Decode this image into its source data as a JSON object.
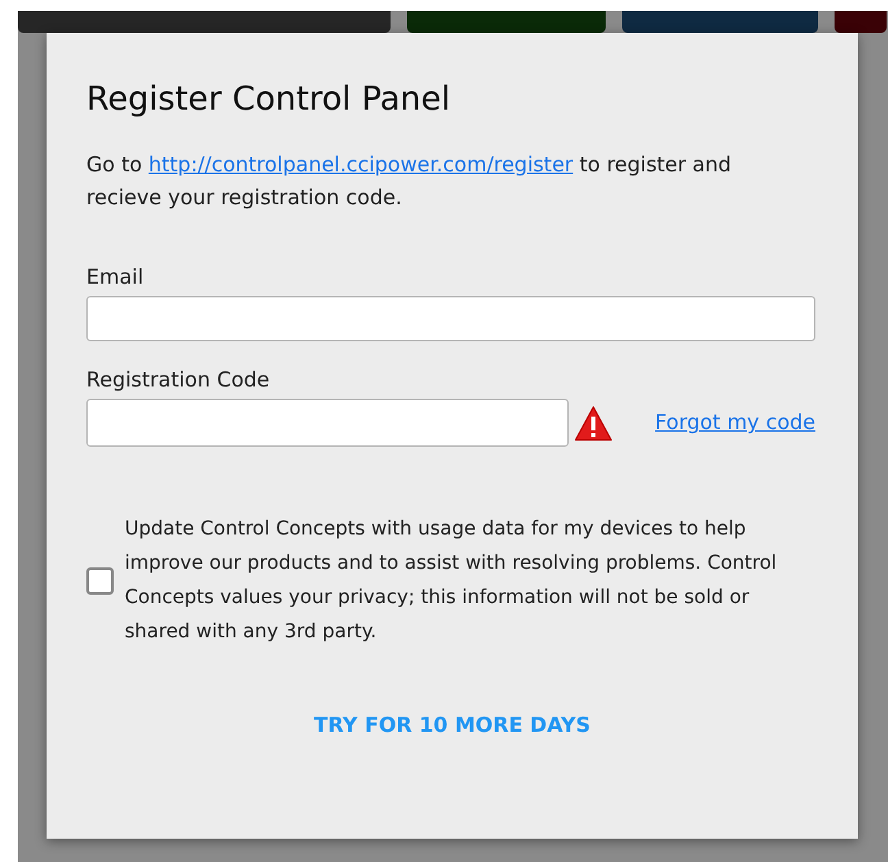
{
  "background_tabs": [
    {
      "color": "#262626"
    },
    {
      "color": "#0a2a08"
    },
    {
      "color": "#0f2a42"
    },
    {
      "color": "#3a0206"
    }
  ],
  "dialog": {
    "title": "Register Control Panel",
    "intro": {
      "before": "Go to ",
      "link": "http://controlpanel.ccipower.com/register",
      "after": " to register and recieve your registration code."
    },
    "email": {
      "label": "Email"
    },
    "code": {
      "label": "Registration Code",
      "error": true,
      "forgot_link": "Forgot my code"
    },
    "consent": {
      "checked": false,
      "text": "Update Control Concepts with usage data for my devices to help improve our products and to assist with resolving problems. Control Concepts values your privacy; this information will not be sold or shared with any 3rd party."
    },
    "button": "TRY FOR 10 MORE DAYS"
  }
}
